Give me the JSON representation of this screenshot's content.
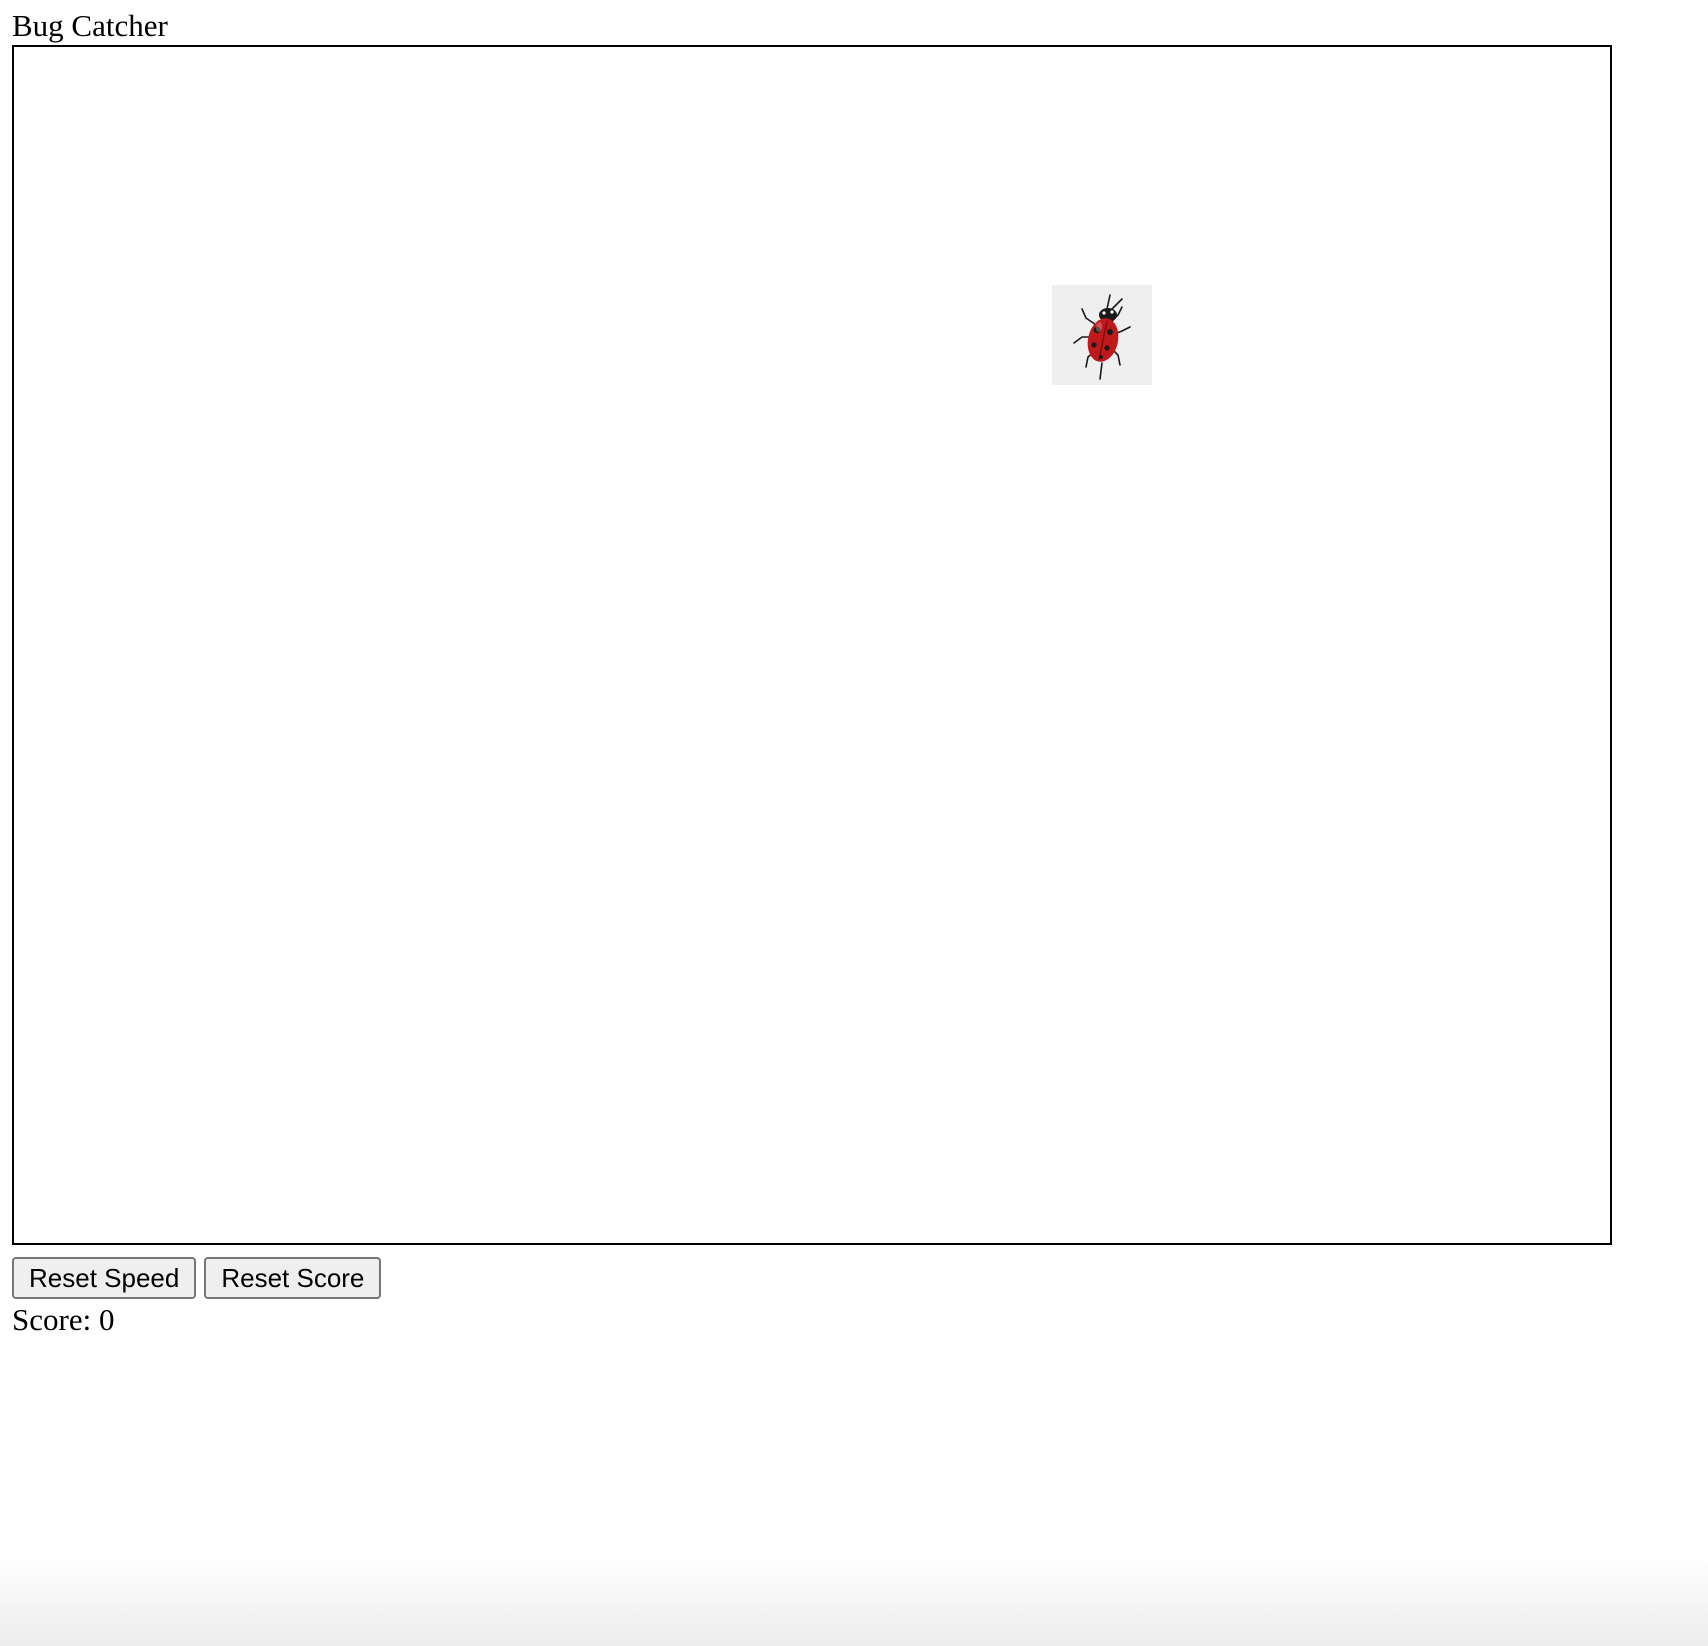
{
  "page": {
    "title": "Bug Catcher"
  },
  "game": {
    "bug": {
      "icon": "ladybug-icon",
      "colors": {
        "shell": "#c0191c",
        "spots": "#1a1a1a",
        "background": "#efefef"
      }
    }
  },
  "controls": {
    "reset_speed_label": "Reset Speed",
    "reset_score_label": "Reset Score"
  },
  "score": {
    "label": "Score:",
    "value": "0"
  }
}
